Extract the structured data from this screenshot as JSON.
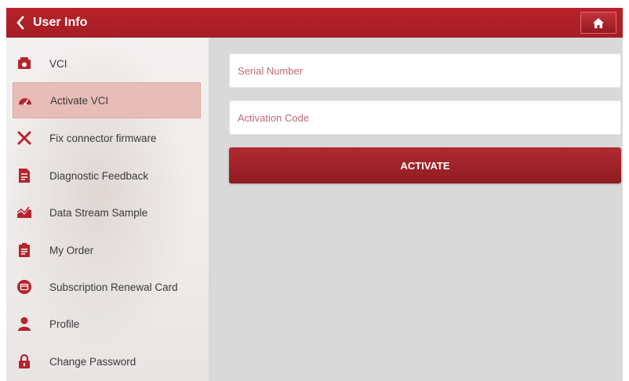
{
  "header": {
    "title": "User Info"
  },
  "colors": {
    "accent": "#b8232b",
    "active_item": "#e9bdb7",
    "placeholder": "#c06a70"
  },
  "sidebar": {
    "items": [
      {
        "label": "VCI",
        "icon": "vci-device-icon"
      },
      {
        "label": "Activate VCI",
        "icon": "dashboard-gauge-icon",
        "active": true
      },
      {
        "label": "Fix connector firmware",
        "icon": "tools-icon"
      },
      {
        "label": "Diagnostic Feedback",
        "icon": "feedback-document-icon"
      },
      {
        "label": "Data Stream Sample",
        "icon": "chart-graph-icon"
      },
      {
        "label": "My Order",
        "icon": "order-clipboard-icon"
      },
      {
        "label": "Subscription Renewal Card",
        "icon": "renewal-card-icon"
      },
      {
        "label": "Profile",
        "icon": "person-icon"
      },
      {
        "label": "Change Password",
        "icon": "lock-icon"
      }
    ]
  },
  "form": {
    "serial_placeholder": "Serial Number",
    "activation_placeholder": "Activation Code",
    "activate_label": "ACTIVATE"
  }
}
